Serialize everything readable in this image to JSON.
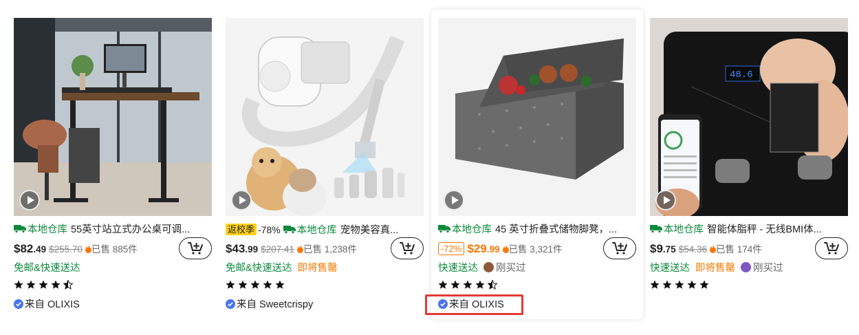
{
  "products": [
    {
      "image_desc": "standing desk",
      "sale_tag": "",
      "sale_pct": "",
      "warehouse": "本地仓库",
      "name": "55英寸站立式办公桌可调...",
      "discount_badge": "",
      "price_main": "$82",
      "price_cents": ".49",
      "price_color": "#222222",
      "old_price": "$255.70",
      "sold": "已售 885件",
      "shipping": "免邮&快速送达",
      "urgency": "",
      "buyer": "",
      "rating": 4.5,
      "seller_prefix": "来自",
      "seller": "OLIXIS"
    },
    {
      "image_desc": "pet grooming vacuum kit",
      "sale_tag": "返校季",
      "sale_pct": "-78%",
      "warehouse": "本地仓库",
      "name": "宠物美容真...",
      "discount_badge": "",
      "price_main": "$43",
      "price_cents": ".99",
      "price_color": "#222222",
      "old_price": "$207.41",
      "sold": "已售 1,238件",
      "shipping": "免邮&快速送达",
      "urgency": "即将售罄",
      "buyer": "",
      "rating": 5,
      "seller_prefix": "来自",
      "seller": "Sweetcrispy"
    },
    {
      "image_desc": "folding storage ottoman",
      "sale_tag": "",
      "sale_pct": "",
      "warehouse": "本地仓库",
      "name": "45 英寸折叠式储物脚凳，...",
      "discount_badge": "-72%",
      "price_main": "$29",
      "price_cents": ".99",
      "price_color": "#fb7701",
      "old_price": "",
      "sold": "已售 3,321件",
      "shipping": "快速送达",
      "urgency": "",
      "buyer": "刚买过",
      "rating": 4.5,
      "seller_prefix": "来自",
      "seller": "OLIXIS"
    },
    {
      "image_desc": "smart body fat scale",
      "sale_tag": "",
      "sale_pct": "",
      "warehouse": "本地仓库",
      "name": "智能体脂秤 - 无线BMI体...",
      "discount_badge": "",
      "price_main": "$9",
      "price_cents": ".75",
      "price_color": "#222222",
      "old_price": "$54.36",
      "sold": "已售 174件",
      "shipping": "快速送达",
      "urgency": "即将售罄",
      "buyer": "刚买过",
      "rating": 5,
      "seller_prefix": "来自",
      "seller": "OLIXIS"
    }
  ],
  "colors": {
    "warehouse_green": "#0a8a3a",
    "accent_orange": "#fb7701",
    "highlight_red": "#e53935",
    "verified_blue": "#4a76e8"
  },
  "icons": [
    "play-icon",
    "truck-icon",
    "flame-icon",
    "cart-add-icon",
    "star-icon",
    "verified-check-icon"
  ]
}
